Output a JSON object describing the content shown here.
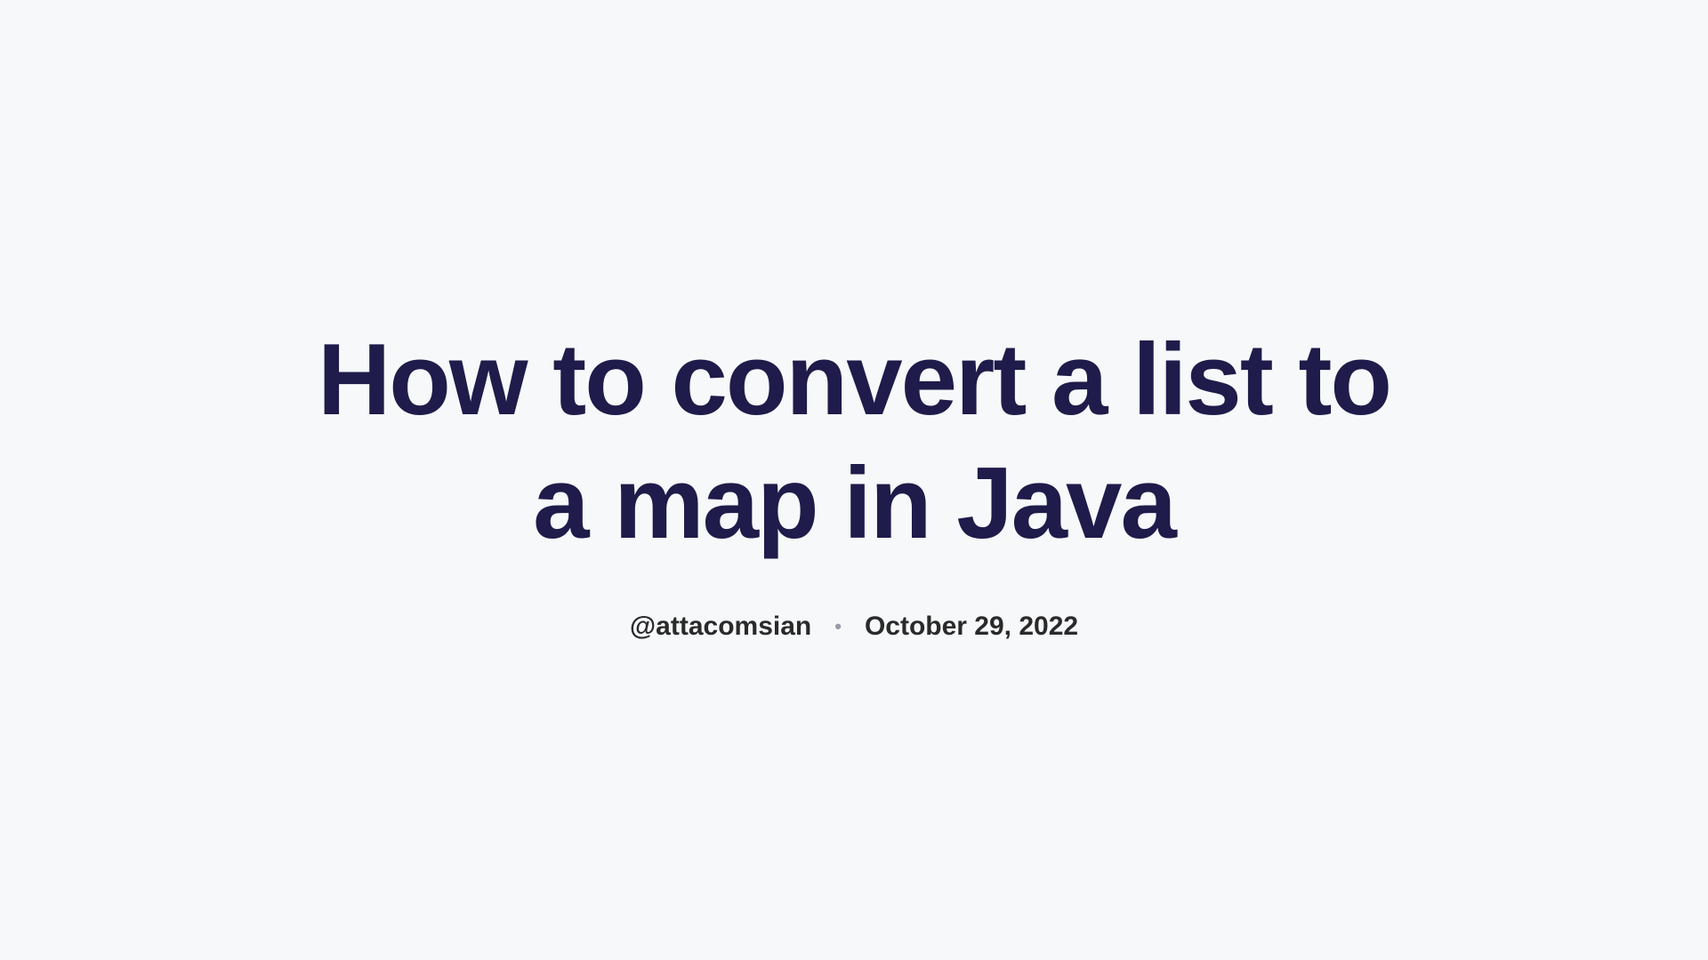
{
  "article": {
    "title": "How to convert a list to a map in Java",
    "author": "@attacomsian",
    "date": "October 29, 2022"
  }
}
